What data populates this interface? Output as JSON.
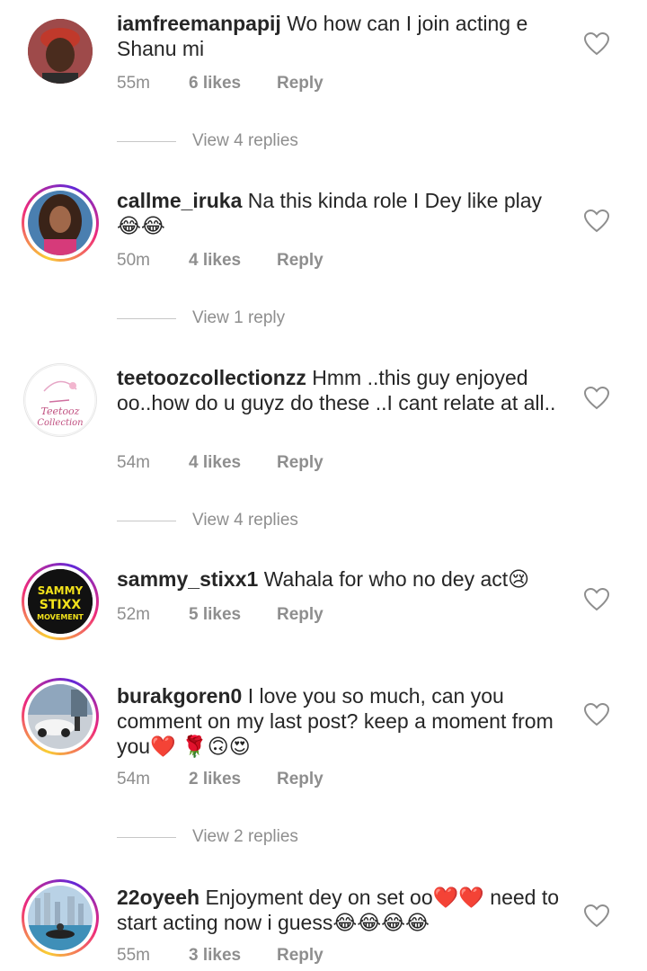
{
  "comments": [
    {
      "username": "iamfreemanpapij",
      "text": "Wo how can I join acting e Shanu mi",
      "time": "55m",
      "likes": "6 likes",
      "reply": "Reply",
      "view_replies": "View 4 replies",
      "avatar_icon": "person-avatar-icon",
      "story_ring": false
    },
    {
      "username": "callme_iruka",
      "text": "Na this kinda role I Dey like play 😂😂",
      "time": "50m",
      "likes": "4 likes",
      "reply": "Reply",
      "view_replies": "View 1 reply",
      "avatar_icon": "person-avatar-icon",
      "story_ring": true
    },
    {
      "username": "teetoozcollectionzz",
      "text": "Hmm ..this guy enjoyed oo..how do u guyz do these ..I cant relate at all..",
      "time": "54m",
      "likes": "4 likes",
      "reply": "Reply",
      "view_replies": "View 4 replies",
      "avatar_icon": "brand-logo-icon",
      "avatar_text": "Teetooz Collection",
      "story_ring": false
    },
    {
      "username": "sammy_stixx1",
      "text": "Wahala for who no dey act😢",
      "time": "52m",
      "likes": "5 likes",
      "reply": "Reply",
      "avatar_icon": "brand-logo-icon",
      "avatar_text": [
        "SAMMY",
        "STIXX",
        "MOVEMENT"
      ],
      "story_ring": true
    },
    {
      "username": "burakgoren0",
      "text": "I love you so much, can you comment on my last post? keep a moment from you❤️ 🌹🙃😍",
      "time": "54m",
      "likes": "2 likes",
      "reply": "Reply",
      "view_replies": "View 2 replies",
      "avatar_icon": "car-photo-icon",
      "story_ring": true
    },
    {
      "username": "22oyeeh",
      "text": "Enjoyment dey on set oo❤️❤️ need to start acting now i guess😂😂😂😂",
      "time": "55m",
      "likes": "3 likes",
      "reply": "Reply",
      "avatar_icon": "jetski-photo-icon",
      "story_ring": true
    }
  ],
  "colors": {
    "text": "#262626",
    "secondary": "#8e8e8e",
    "story_ring": "#ee2a7b"
  }
}
